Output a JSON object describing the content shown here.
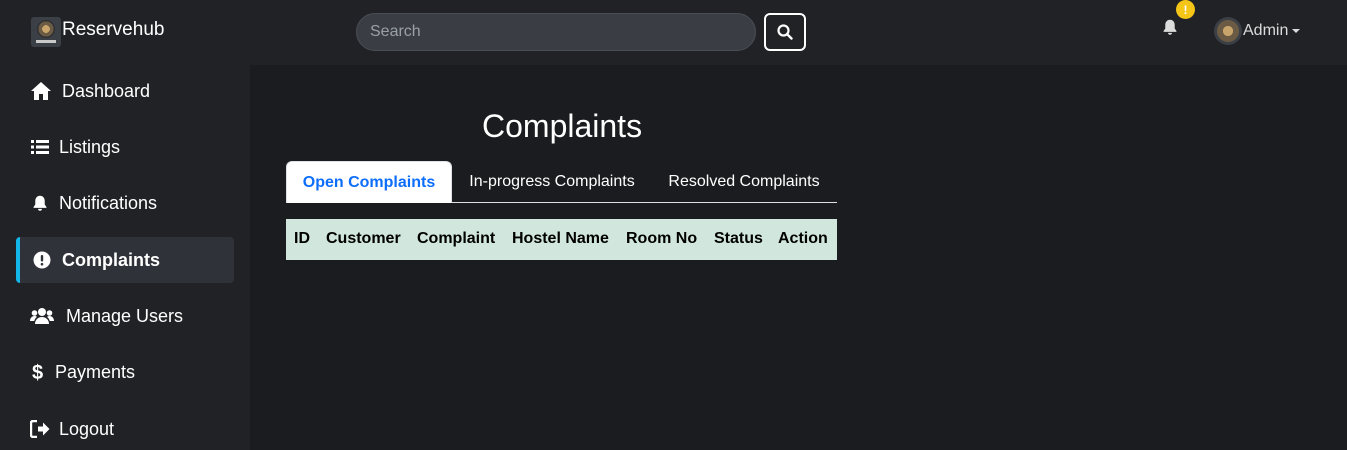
{
  "brand": {
    "name": "Reservehub"
  },
  "search": {
    "placeholder": "Search"
  },
  "notifications": {
    "badge": "!"
  },
  "user": {
    "label": "Admin"
  },
  "sidebar": {
    "items": [
      {
        "label": "Dashboard",
        "icon": "home-icon"
      },
      {
        "label": "Listings",
        "icon": "list-icon"
      },
      {
        "label": "Notifications",
        "icon": "bell-icon"
      },
      {
        "label": "Complaints",
        "icon": "exclamation-circle-icon",
        "active": true
      },
      {
        "label": "Manage Users",
        "icon": "users-icon"
      },
      {
        "label": "Payments",
        "icon": "dollar-icon"
      },
      {
        "label": "Logout",
        "icon": "logout-icon"
      }
    ]
  },
  "main": {
    "title": "Complaints",
    "tabs": [
      {
        "label": "Open Complaints",
        "active": true
      },
      {
        "label": "In-progress Complaints"
      },
      {
        "label": "Resolved Complaints"
      }
    ],
    "table": {
      "columns": [
        "ID",
        "Customer",
        "Complaint",
        "Hostel Name",
        "Room No",
        "Status",
        "Action"
      ],
      "rows": []
    }
  },
  "colors": {
    "accent": "#13b6e9",
    "active_tab_text": "#0d6efd",
    "table_header_bg": "#d1e7dd",
    "badge": "#f5c518"
  }
}
